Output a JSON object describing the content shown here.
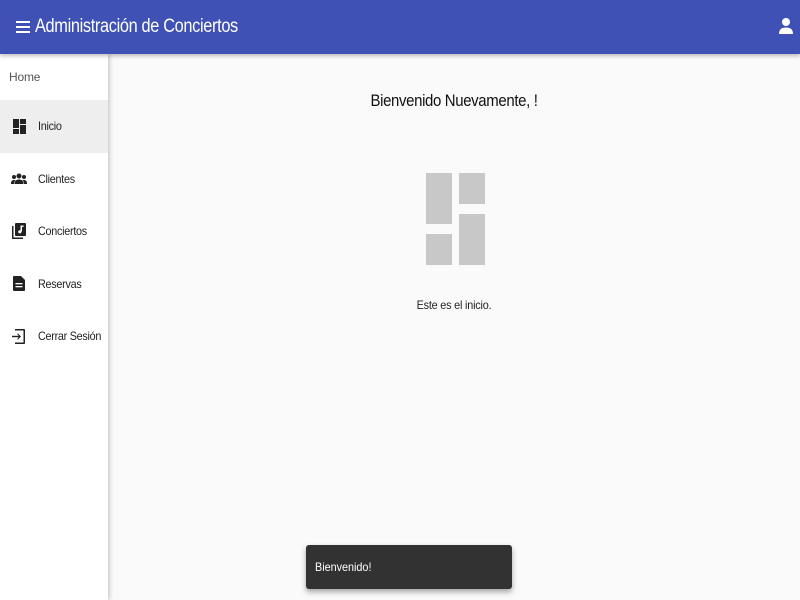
{
  "header": {
    "title": "Administración de Conciertos",
    "menu_icon": "hamburger-menu-icon",
    "user_icon": "account-icon",
    "color": "#3f51b5"
  },
  "sidebar": {
    "header": "Home",
    "items": [
      {
        "label": "Inicio",
        "icon": "dashboard-icon",
        "active": true
      },
      {
        "label": "Clientes",
        "icon": "people-icon",
        "active": false
      },
      {
        "label": "Conciertos",
        "icon": "music-library-icon",
        "active": false
      },
      {
        "label": "Reservas",
        "icon": "description-icon",
        "active": false
      },
      {
        "label": "Cerrar Sesión",
        "icon": "logout-icon",
        "active": false
      }
    ]
  },
  "main": {
    "welcome": "Bienvenido Nuevamente, !",
    "icon": "dashboard-icon",
    "subtitle": "Este es el inicio."
  },
  "snackbar": {
    "message": "Bienvenido!"
  }
}
